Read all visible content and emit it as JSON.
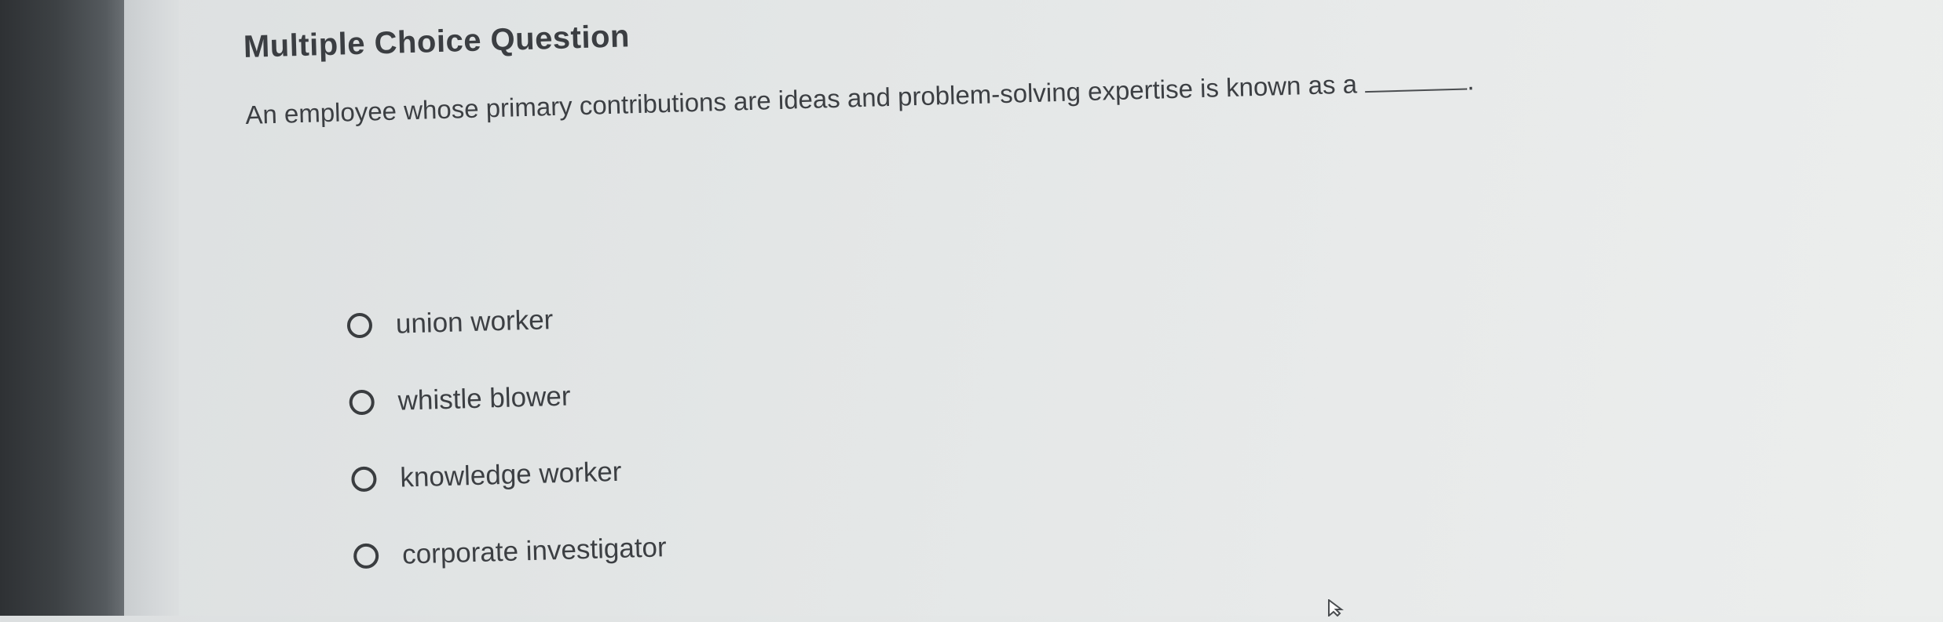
{
  "page": {
    "title": "Multiple Choice Question"
  },
  "question": {
    "text": "An employee whose primary contributions are ideas and problem-solving expertise is known as a",
    "suffix": "."
  },
  "options": [
    {
      "label": "union worker",
      "selected": false
    },
    {
      "label": "whistle blower",
      "selected": false
    },
    {
      "label": "knowledge worker",
      "selected": false
    },
    {
      "label": "corporate investigator",
      "selected": false
    }
  ],
  "icons": {
    "radio": "radio-unchecked-icon",
    "cursor": "mouse-pointer-icon"
  },
  "colors": {
    "text": "#3c3f43",
    "background": "#e3e6e6",
    "bezel": "#3d4144"
  }
}
